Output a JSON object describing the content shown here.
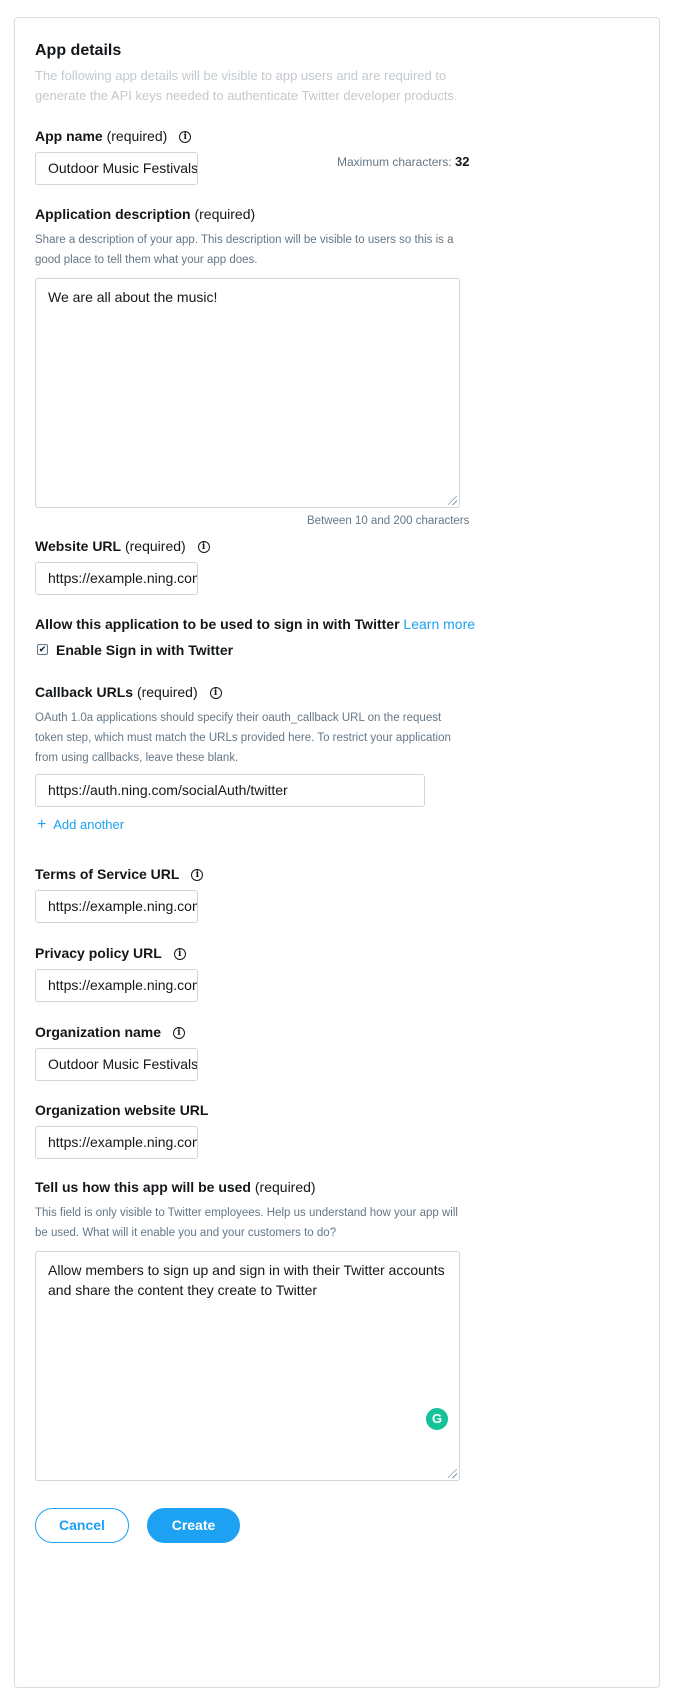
{
  "section": {
    "title": "App details",
    "intro": "The following app details will be visible to app users and are required to generate the API keys needed to authenticate Twitter developer products."
  },
  "info_icon_glyph": "i",
  "required_text": "(required)",
  "app_name": {
    "label": "App name",
    "value": "Outdoor Music Festivals",
    "max_label": "Maximum characters:",
    "max_value": "32"
  },
  "app_description": {
    "label": "Application description",
    "help": "Share a description of your app. This description will be visible to users so this is a good place to tell them what your app does.",
    "value": "We are all about the music!",
    "limit_note": "Between 10 and 200 characters"
  },
  "website_url": {
    "label": "Website URL",
    "value": "https://example.ning.com"
  },
  "sign_in": {
    "label": "Allow this application to be used to sign in with Twitter",
    "learn_more": "Learn more",
    "checkbox_label": "Enable Sign in with Twitter",
    "checked": true,
    "check_glyph": "✔"
  },
  "callback_urls": {
    "label": "Callback URLs",
    "help": "OAuth 1.0a applications should specify their oauth_callback URL on the request token step, which must match the URLs provided here. To restrict your application from using callbacks, leave these blank.",
    "value": "https://auth.ning.com/socialAuth/twitter",
    "add_another": "Add another",
    "plus_glyph": "+"
  },
  "terms_url": {
    "label": "Terms of Service URL",
    "value": "https://example.ning.com"
  },
  "privacy_url": {
    "label": "Privacy policy URL",
    "value": "https://example.ning.com"
  },
  "org_name": {
    "label": "Organization name",
    "value": "Outdoor Music Festivals"
  },
  "org_url": {
    "label": "Organization website URL",
    "value": "https://example.ning.com"
  },
  "usage": {
    "label": "Tell us how this app will be used",
    "help": "This field is only visible to Twitter employees. Help us understand how your app will be used. What will it enable you and your customers to do?",
    "value": "Allow members to sign up and sign in with their Twitter accounts and share the content they create to Twitter",
    "grammarly_glyph": "G"
  },
  "buttons": {
    "cancel": "Cancel",
    "create": "Create"
  },
  "colors": {
    "accent": "#1da1f2",
    "border": "#ccd6dd",
    "muted_text": "#657786",
    "grammarly": "#15c39a"
  },
  "icons": [
    "info-icon",
    "checkbox-icon",
    "plus-icon",
    "resize-handle-icon",
    "grammarly-icon"
  ]
}
